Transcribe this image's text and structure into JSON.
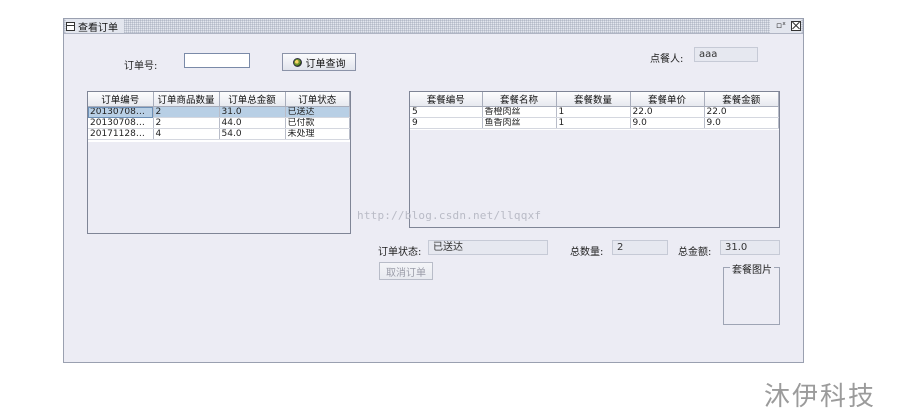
{
  "window": {
    "title": "查看订单",
    "max_glyph": "▫ˣ"
  },
  "search": {
    "label": "订单号:",
    "value": "",
    "button_label": "订单查询"
  },
  "customer": {
    "label": "点餐人:",
    "value": "aaa"
  },
  "orders_table": {
    "columns": [
      "订单编号",
      "订单商品数量",
      "订单总金额",
      "订单状态"
    ],
    "rows": [
      [
        "20130708110...",
        "2",
        "31.0",
        "已送达"
      ],
      [
        "20130708110...",
        "2",
        "44.0",
        "已付款"
      ],
      [
        "20171128140...",
        "4",
        "54.0",
        "未处理"
      ]
    ],
    "selected_row": 0
  },
  "meals_table": {
    "columns": [
      "套餐编号",
      "套餐名称",
      "套餐数量",
      "套餐单价",
      "套餐金额"
    ],
    "rows": [
      [
        "5",
        "香橙肉丝",
        "1",
        "22.0",
        "22.0"
      ],
      [
        "9",
        "鱼香肉丝",
        "1",
        "9.0",
        "9.0"
      ]
    ]
  },
  "details": {
    "status_label": "订单状态:",
    "status_value": "已送达",
    "qty_label": "总数量:",
    "qty_value": "2",
    "amount_label": "总金额:",
    "amount_value": "31.0",
    "cancel_label": "取消订单",
    "image_legend": "套餐图片"
  },
  "watermark": "http://blog.csdn.net/llqqxf",
  "brand": "沐伊科技",
  "colors": {
    "selection": "#b8cfe5",
    "panel": "#ececf4"
  }
}
